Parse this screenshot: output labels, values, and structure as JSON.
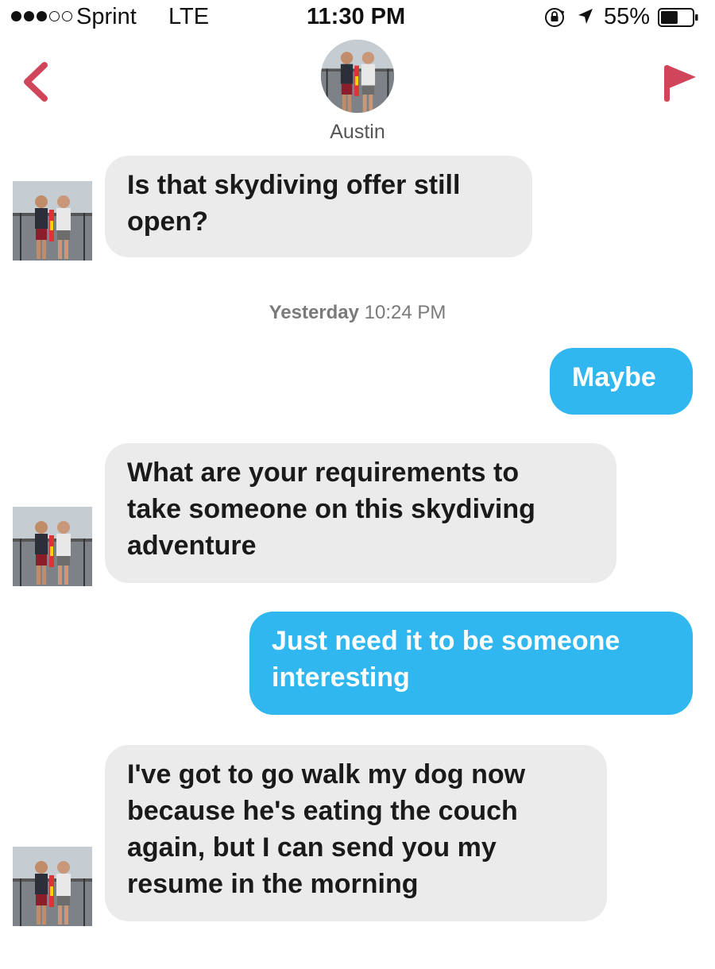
{
  "status_bar": {
    "carrier": "Sprint",
    "network": "LTE",
    "time": "11:30 PM",
    "battery": "55%",
    "battery_level": 0.55,
    "icons": [
      "signal-dots-icon",
      "rotation-lock-icon",
      "location-arrow-icon",
      "battery-icon"
    ]
  },
  "header": {
    "contact_name": "Austin",
    "back_icon": "chevron-left-icon",
    "flag_icon": "flag-icon",
    "accent_color": "#d0455a"
  },
  "timestamp": {
    "day": "Yesterday",
    "time": "10:24 PM"
  },
  "messages": [
    {
      "direction": "incoming",
      "text": "Is that skydiving offer still\nopen?"
    },
    {
      "direction": "outgoing",
      "text": "Maybe"
    },
    {
      "direction": "incoming",
      "text": "What are your requirements to\ntake someone on this skydiving\nadventure"
    },
    {
      "direction": "outgoing",
      "text": "Just need it to be someone\ninteresting"
    },
    {
      "direction": "incoming",
      "text": "I've got to go walk my dog now\nbecause he's eating the couch\nagain, but I can send you my\nresume in the morning"
    }
  ],
  "colors": {
    "incoming_bubble": "#ebebeb",
    "outgoing_bubble": "#30b7f0"
  }
}
